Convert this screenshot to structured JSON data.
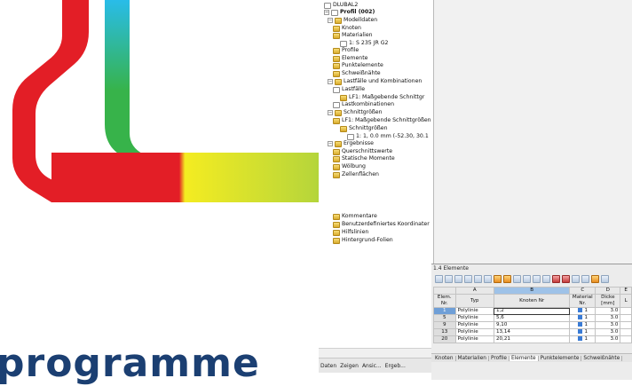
{
  "brand_text": "programme",
  "colors": {
    "red": "#e31e26",
    "yellow": "#f4ec21",
    "green": "#37b34a",
    "cyan": "#29bce9",
    "blue": "#1a4ea1",
    "brand": "#1b3f72"
  },
  "tree": {
    "items": [
      {
        "label": "DLUBAL2",
        "icon": "doc-icon"
      },
      {
        "label": "Profil (002)",
        "icon": "doc-icon",
        "bold": true
      },
      {
        "label": "Modelldaten",
        "icon": "folder-icon"
      },
      {
        "label": "Knoten",
        "icon": "folder-icon"
      },
      {
        "label": "Materialien",
        "icon": "folder-icon"
      },
      {
        "label": "1: S 235 JR G2",
        "icon": "material-icon"
      },
      {
        "label": "Profile",
        "icon": "folder-icon"
      },
      {
        "label": "Elemente",
        "icon": "folder-icon"
      },
      {
        "label": "Punktelemente",
        "icon": "folder-icon"
      },
      {
        "label": "Schweißnähte",
        "icon": "folder-icon"
      },
      {
        "label": "Lastfälle und Kombinationen",
        "icon": "folder-icon"
      },
      {
        "label": "Lastfälle",
        "icon": "load-icon"
      },
      {
        "label": "LF1: Maßgebende Schnittgr",
        "icon": "folder-icon"
      },
      {
        "label": "Lastkombinationen",
        "icon": "load-icon"
      },
      {
        "label": "Schnittgrößen",
        "icon": "folder-icon"
      },
      {
        "label": "LF1: Maßgebende Schnittgrößen",
        "icon": "folder-icon"
      },
      {
        "label": "Schnittgrößen",
        "icon": "folder-icon"
      },
      {
        "label": "1: 1, 0.0 mm (-52.30, 30.1",
        "icon": "force-icon"
      },
      {
        "label": "Ergebnisse",
        "icon": "folder-icon"
      },
      {
        "label": "Querschnittswerte",
        "icon": "folder-icon"
      },
      {
        "label": "Statische Momente",
        "icon": "folder-icon"
      },
      {
        "label": "Wölbung",
        "icon": "folder-icon"
      },
      {
        "label": "Zellenflächen",
        "icon": "folder-icon"
      },
      {
        "label": "Kommentare",
        "icon": "folder-icon"
      },
      {
        "label": "Benutzerdefiniertes Koordinater",
        "icon": "folder-icon"
      },
      {
        "label": "Hilfslinien",
        "icon": "folder-icon"
      },
      {
        "label": "Hintergrund-Folien",
        "icon": "folder-icon"
      }
    ]
  },
  "nav_tabs": [
    "Daten",
    "Zeigen",
    "Ansic...",
    "Ergeb..."
  ],
  "table": {
    "title": "1.4 Elemente",
    "col_letters": [
      "A",
      "B",
      "C",
      "D",
      "E"
    ],
    "headers": [
      "Elem. Nr.",
      "Typ",
      "Knoten Nr",
      "Material Nr.",
      "Dicke [mm]",
      "L"
    ],
    "rows": [
      {
        "nr": "1",
        "typ": "Polylinie",
        "knoten": "1,2",
        "mat": "1",
        "dicke": "3.0"
      },
      {
        "nr": "5",
        "typ": "Polylinie",
        "knoten": "5,6",
        "mat": "1",
        "dicke": "3.0"
      },
      {
        "nr": "9",
        "typ": "Polylinie",
        "knoten": "9,10",
        "mat": "1",
        "dicke": "3.0"
      },
      {
        "nr": "13",
        "typ": "Polylinie",
        "knoten": "13,14",
        "mat": "1",
        "dicke": "3.0"
      },
      {
        "nr": "20",
        "typ": "Polylinie",
        "knoten": "20,21",
        "mat": "1",
        "dicke": "3.0"
      }
    ],
    "sheet_tabs": [
      "Knoten",
      "Materialien",
      "Profile",
      "Elemente",
      "Punktelemente",
      "Schweißnähte"
    ],
    "current_tab": "Elemente"
  }
}
